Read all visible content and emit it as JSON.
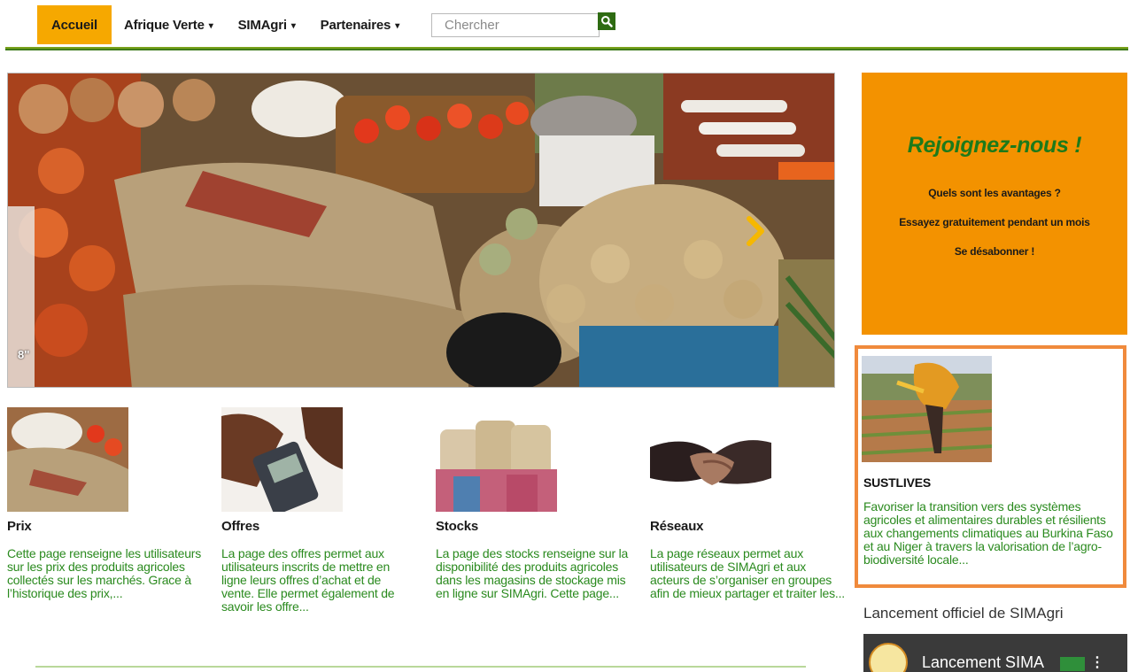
{
  "nav": {
    "items": [
      {
        "label": "Accueil",
        "active": true,
        "dropdown": false
      },
      {
        "label": "Afrique Verte",
        "active": false,
        "dropdown": true
      },
      {
        "label": "SIMAgri",
        "active": false,
        "dropdown": true
      },
      {
        "label": "Partenaires",
        "active": false,
        "dropdown": true
      }
    ],
    "search_placeholder": "Chercher",
    "search_icon": "search-icon"
  },
  "hero": {
    "counter": "8\"",
    "next_icon": "chevron-right-icon"
  },
  "cards": [
    {
      "title": "Prix",
      "text": "Cette page renseigne les utilisateurs sur les prix des produits agricoles collectés sur les marchés. Grace à l’historique des prix,..."
    },
    {
      "title": "Offres",
      "text": "La page des offres permet aux utilisateurs inscrits de mettre en ligne leurs offres d’achat et de vente. Elle permet également de savoir les offre..."
    },
    {
      "title": "Stocks",
      "text": "La page des stocks renseigne sur la disponibilité des produits agricoles dans les magasins de stockage mis en ligne sur SIMAgri. Cette page..."
    },
    {
      "title": "Réseaux",
      "text": "La page réseaux permet aux utilisateurs de SIMAgri et aux acteurs de s’organiser en groupes afin de mieux partager et traiter les..."
    }
  ],
  "join": {
    "title": "Rejoignez-nous !",
    "links": [
      "Quels sont les avantages ?",
      "Essayez gratuitement pendant un mois",
      "Se désabonner !"
    ]
  },
  "sustlives": {
    "title": "SUSTLIVES",
    "text": "Favoriser la transition vers des systèmes agricoles et alimentaires durables et résilients aux changements climatiques au Burkina Faso et au Niger à travers la valorisation de l’agro-biodiversité locale..."
  },
  "video": {
    "heading": "Lancement officiel de SIMAgri",
    "title": "Lancement SIMA"
  },
  "colors": {
    "accent": "#f6a800",
    "join_bg": "#f39200",
    "green_text": "#2a8a1e",
    "nav_rule": "#3e7a1a",
    "sust_border": "#f08a3c"
  }
}
